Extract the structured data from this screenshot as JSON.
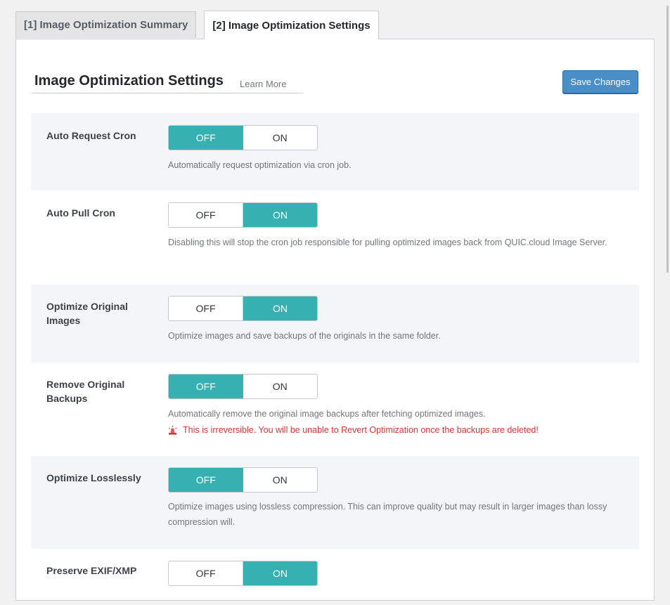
{
  "tabs": [
    {
      "label": "[1] Image Optimization Summary",
      "active": false
    },
    {
      "label": "[2] Image Optimization Settings",
      "active": true
    }
  ],
  "header": {
    "title": "Image Optimization Settings",
    "learn_more": "Learn More",
    "save_label": "Save Changes"
  },
  "colors": {
    "accent_teal": "#36b0b0",
    "save_blue": "#4a8ec7",
    "warning_red": "#dc3232"
  },
  "settings": [
    {
      "label": "Auto Request Cron",
      "off": "OFF",
      "on": "ON",
      "value": "OFF",
      "description": "Automatically request optimization via cron job."
    },
    {
      "label": "Auto Pull Cron",
      "off": "OFF",
      "on": "ON",
      "value": "ON",
      "description": "Disabling this will stop the cron job responsible for pulling optimized images back from QUIC.cloud Image Server."
    },
    {
      "label": "Optimize Original Images",
      "off": "OFF",
      "on": "ON",
      "value": "ON",
      "description": "Optimize images and save backups of the originals in the same folder."
    },
    {
      "label": "Remove Original Backups",
      "off": "OFF",
      "on": "ON",
      "value": "OFF",
      "description": "Automatically remove the original image backups after fetching optimized images.",
      "warning": "This is irreversible. You will be unable to Revert Optimization once the backups are deleted!",
      "warning_icon": "warning-siren-icon"
    },
    {
      "label": "Optimize Losslessly",
      "off": "OFF",
      "on": "ON",
      "value": "OFF",
      "description": "Optimize images using lossless compression. This can improve quality but may result in larger images than lossy compression will."
    },
    {
      "label": "Preserve EXIF/XMP",
      "off": "OFF",
      "on": "ON",
      "value": "ON",
      "description": ""
    }
  ]
}
